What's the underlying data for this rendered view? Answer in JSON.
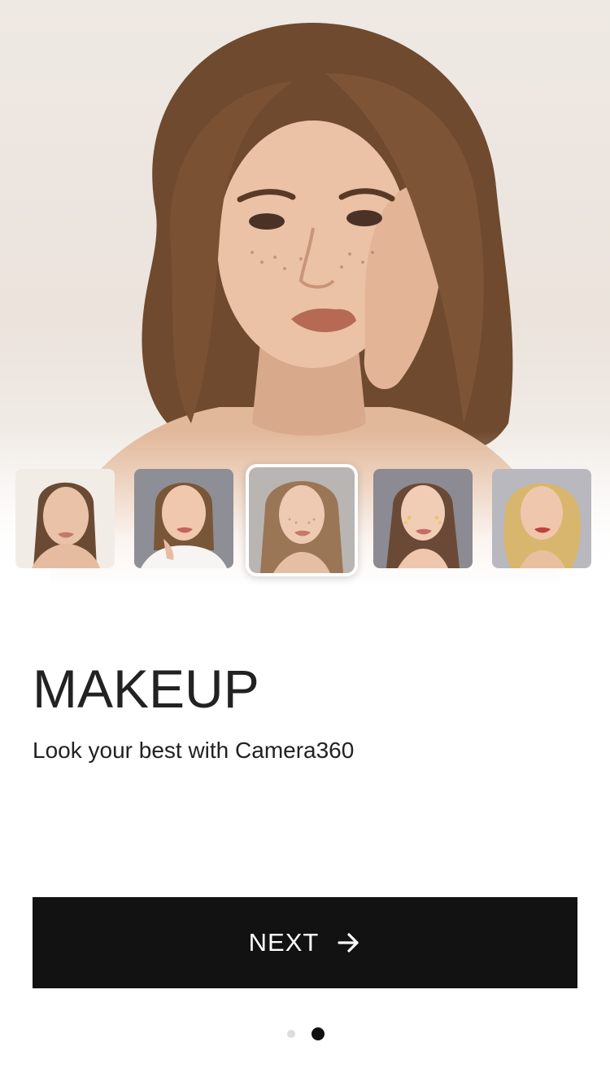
{
  "hero": {
    "image": "portrait-woman-wavy-brown-hair"
  },
  "thumbnails": [
    {
      "image": "portrait-woman-ponytail-light-makeup",
      "selected": false
    },
    {
      "image": "portrait-woman-hand-on-chin",
      "selected": false
    },
    {
      "image": "portrait-woman-long-straight-hair",
      "selected": true
    },
    {
      "image": "portrait-woman-sparkle-makeup",
      "selected": false
    },
    {
      "image": "portrait-woman-blonde-curls",
      "selected": false
    }
  ],
  "onboarding": {
    "title": "MAKEUP",
    "subtitle": "Look your best with Camera360"
  },
  "next_button": {
    "label": "NEXT",
    "icon": "arrow-right-icon"
  },
  "pager": {
    "total": 2,
    "active_index": 1
  },
  "colors": {
    "button_bg": "#121212",
    "text": "#222222",
    "dot_active": "#111111",
    "dot_inactive": "#dddddd"
  }
}
